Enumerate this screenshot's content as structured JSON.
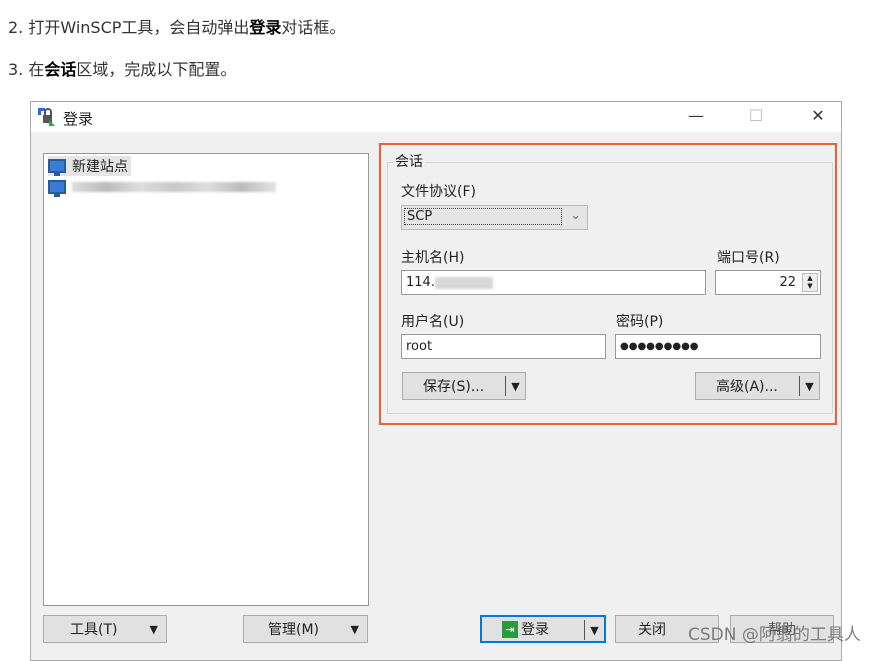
{
  "steps": [
    {
      "prefix": "2. 打开WinSCP工具，会自动弹出",
      "bold": "登录",
      "suffix": "对话框。"
    },
    {
      "prefix": "3. 在",
      "bold": "会话",
      "suffix": "区域，完成以下配置。"
    }
  ],
  "dialog": {
    "title": "登录",
    "window_controls": {
      "minimize": "—",
      "maximize": "☐",
      "close": "✕"
    },
    "sites": [
      {
        "label": "新建站点",
        "icon": "monitor-icon"
      },
      {
        "label": "",
        "icon": "monitor-icon",
        "blurred": true
      }
    ],
    "session": {
      "legend": "会话",
      "protocol_label": "文件协议(F)",
      "protocol_value": "SCP",
      "host_label": "主机名(H)",
      "host_value": "114.",
      "port_label": "端口号(R)",
      "port_value": "22",
      "user_label": "用户名(U)",
      "user_value": "root",
      "password_label": "密码(P)",
      "password_value": "●●●●●●●●●",
      "save_button": "保存(S)...",
      "advanced_button": "高级(A)..."
    },
    "bottom": {
      "tools": "工具(T)",
      "manage": "管理(M)",
      "login": "登录",
      "close": "关闭",
      "help": "帮助"
    }
  },
  "highlight_color": "#e8603c",
  "watermark": "CSDN @阿翡的工具人"
}
